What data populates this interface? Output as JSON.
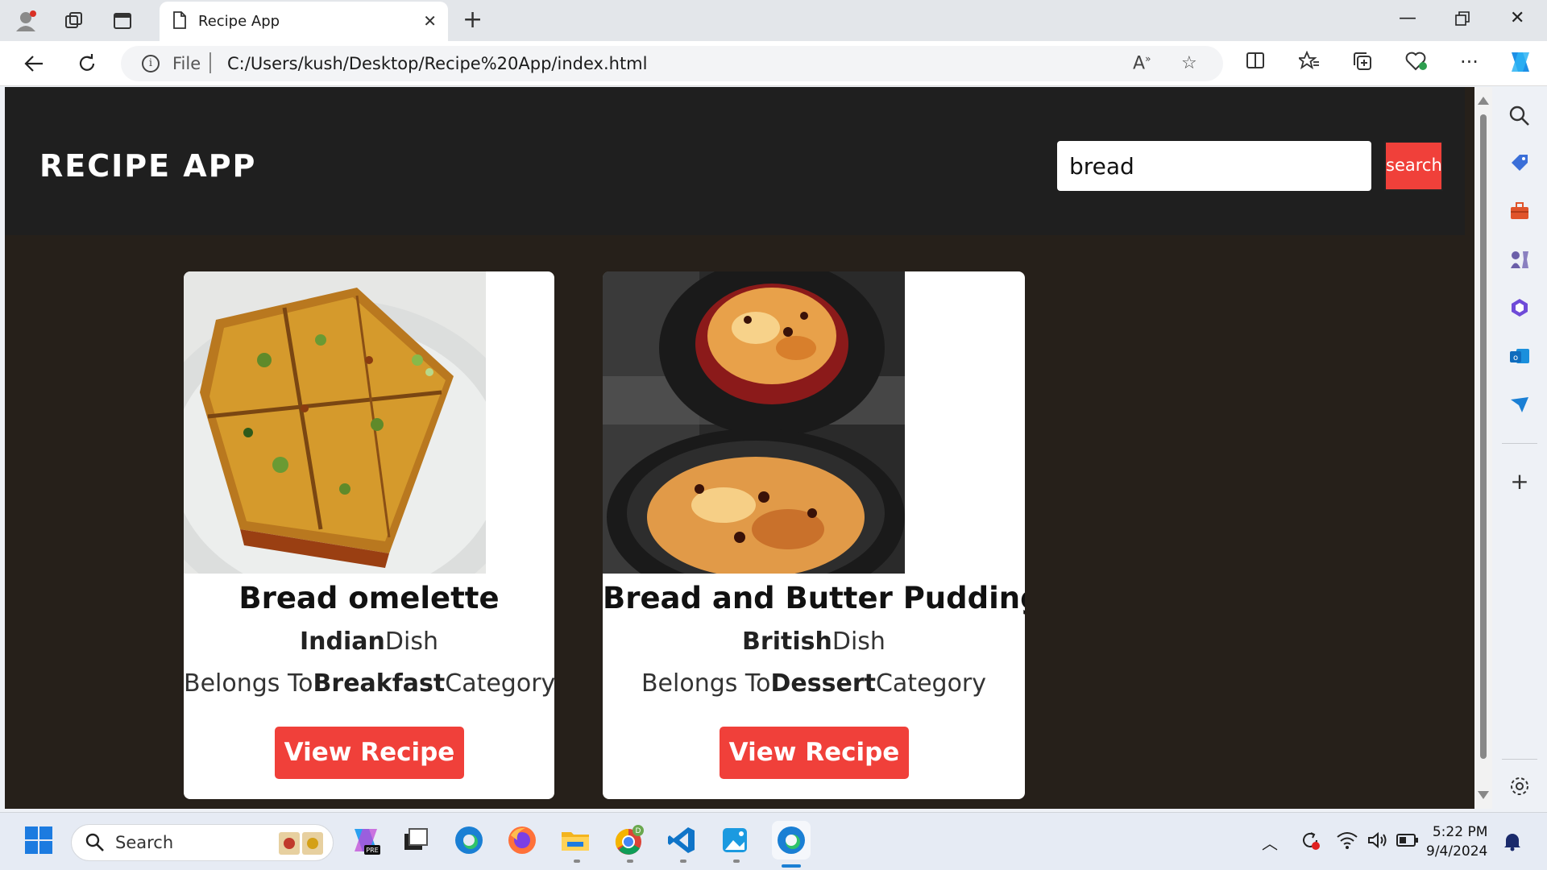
{
  "browser": {
    "tab_title": "Recipe App",
    "url_scheme": "File",
    "url": "C:/Users/kush/Desktop/Recipe%20App/index.html"
  },
  "app": {
    "title": "RECIPE APP",
    "search_value": "bread",
    "search_button": "search"
  },
  "recipes": [
    {
      "name": "Bread omelette",
      "area": "Indian",
      "area_suffix": "Dish",
      "category_prefix": "Belongs To",
      "category": "Breakfast",
      "category_suffix": "Category",
      "button": "View Recipe"
    },
    {
      "name": "Bread and Butter Pudding",
      "area": "British",
      "area_suffix": "Dish",
      "category_prefix": "Belongs To",
      "category": "Dessert",
      "category_suffix": "Category",
      "button": "View Recipe"
    }
  ],
  "taskbar": {
    "search_placeholder": "Search",
    "time": "5:22 PM",
    "date": "9/4/2024"
  },
  "colors": {
    "accent": "#f0403a",
    "header": "#1f1f1f",
    "page_bg": "#26201a"
  }
}
